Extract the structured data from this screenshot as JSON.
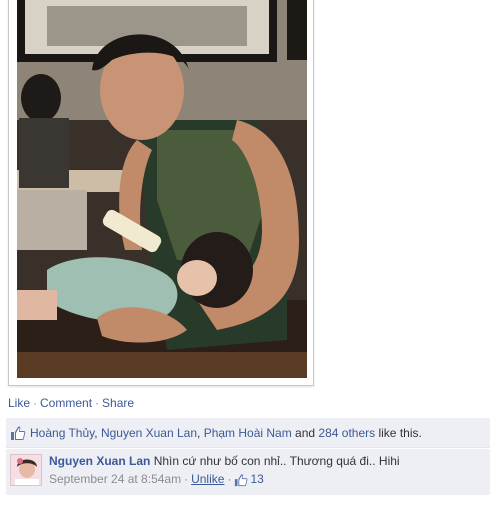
{
  "photo": {
    "alt_icon": "photo-image"
  },
  "actions": {
    "like_label": "Like",
    "comment_label": "Comment",
    "share_label": "Share",
    "separator": "·"
  },
  "likes": {
    "icon": "thumbs-up-icon",
    "person1": "Hoàng Thủy",
    "sep1": ", ",
    "person2": "Nguyen Xuan Lan",
    "sep2": ", ",
    "person3": "Phạm Hoài Nam",
    "and_text": " and ",
    "others_label": "284 others",
    "suffix": " like this."
  },
  "comment": {
    "author": "Nguyen Xuan Lan",
    "text": "Nhìn cứ như bố con nhỉ.. Thương quá đi.. Hihi",
    "timestamp": "September 24 at 8:54am",
    "sep": "·",
    "unlike_label": "Unlike",
    "like_count": "13"
  },
  "colors": {
    "link": "#3b5998",
    "ufi_background": "#edeff4",
    "meta_text": "#8c8c8c"
  }
}
